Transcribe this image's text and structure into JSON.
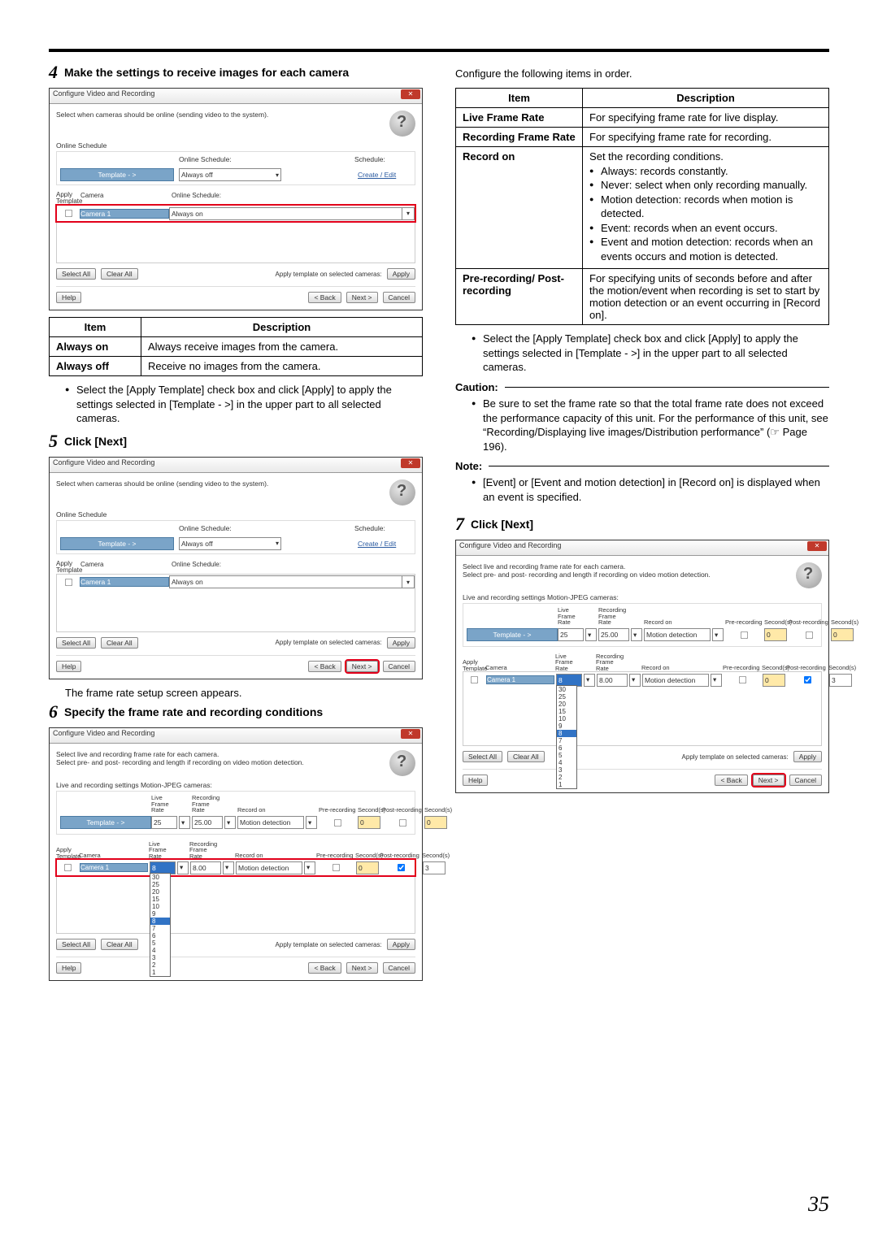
{
  "pageNumber": "35",
  "left": {
    "step4": {
      "num": "4",
      "title": "Make the settings to receive images for each camera"
    },
    "dlg1": {
      "title": "Configure Video and Recording",
      "desc": "Select when cameras should be online (sending video to the system).",
      "sections": {
        "onlineSchedule": "Online Schedule",
        "templateBtn": "Template - >",
        "onlineScheduleLbl": "Online Schedule:",
        "alwaysOff": "Always off",
        "scheduleLbl": "Schedule:",
        "createEdit": "Create / Edit",
        "applyTemplate": "Apply\nTemplate",
        "camera": "Camera",
        "camera1": "Camera 1",
        "alwaysOn": "Always on",
        "selectAll": "Select All",
        "clearAll": "Clear All",
        "applyTemplateSel": "Apply template on selected cameras:",
        "apply": "Apply",
        "help": "Help",
        "back": "< Back",
        "next": "Next >",
        "cancel": "Cancel"
      }
    },
    "table1": {
      "hItem": "Item",
      "hDesc": "Description",
      "r1Item": "Always on",
      "r1Desc": "Always receive images from the camera.",
      "r2Item": "Always off",
      "r2Desc": "Receive no images from the camera."
    },
    "bullet1": "Select the [Apply Template] check box and click [Apply] to apply the settings selected in [Template - >] in the upper part to all selected cameras.",
    "step5": {
      "num": "5",
      "title": "Click [Next]"
    },
    "afterDlg2": "The frame rate setup screen appears.",
    "step6": {
      "num": "6",
      "title": "Specify the frame rate and recording conditions"
    },
    "dlg3": {
      "desc1": "Select live and recording frame rate for each camera.",
      "desc2": "Select pre- and post- recording and length if recording on video motion detection.",
      "settingsLbl": "Live and recording settings Motion-JPEG cameras:",
      "liveFR": "Live\nFrame Rate",
      "recFR": "Recording\nFrame Rate",
      "recordOn": "Record on",
      "preRec": "Pre-recording",
      "sec": "Second(s)",
      "postRec": "Post-recording",
      "v25": "25",
      "v2500": "25.00",
      "motion": "Motion detection",
      "v8": "8",
      "v800": "8.00",
      "v0": "0",
      "v3": "3",
      "ddVals": [
        "30",
        "25",
        "20",
        "15",
        "10",
        "9",
        "8",
        "7",
        "6",
        "5",
        "4",
        "3",
        "2",
        "1"
      ],
      "ddSel": "8"
    }
  },
  "right": {
    "intro": "Configure the following items in order.",
    "table2": {
      "hItem": "Item",
      "hDesc": "Description",
      "rows": [
        {
          "item": "Live Frame Rate",
          "desc": "For specifying frame rate for live display."
        },
        {
          "item": "Recording Frame Rate",
          "desc": "For specifying frame rate for recording."
        },
        {
          "item": "Record on",
          "desc": "Set the recording conditions.",
          "sub": [
            "Always: records constantly.",
            "Never: select when only recording manually.",
            "Motion detection: records when motion is detected.",
            "Event: records when an event occurs.",
            "Event and motion detection: records when an events occurs and motion is detected."
          ]
        },
        {
          "item": "Pre-recording/ Post-recording",
          "desc": "For specifying units of seconds before and after the motion/event when recording is set to start by motion detection or an event occurring in [Record on]."
        }
      ]
    },
    "bullet2": "Select the [Apply Template] check box and click [Apply] to apply the settings selected in [Template - >] in the upper part to all selected cameras.",
    "cautionLabel": "Caution:",
    "cautionText": "Be sure to set the frame rate so that the total frame rate does not exceed the performance capacity of this unit. For the performance of this unit, see “Recording/Displaying live images/Distribution performance” (☞ Page 196).",
    "noteLabel": "Note:",
    "noteText": "[Event] or [Event and motion detection] in [Record on] is displayed when an event is specified.",
    "step7": {
      "num": "7",
      "title": "Click [Next]"
    }
  }
}
